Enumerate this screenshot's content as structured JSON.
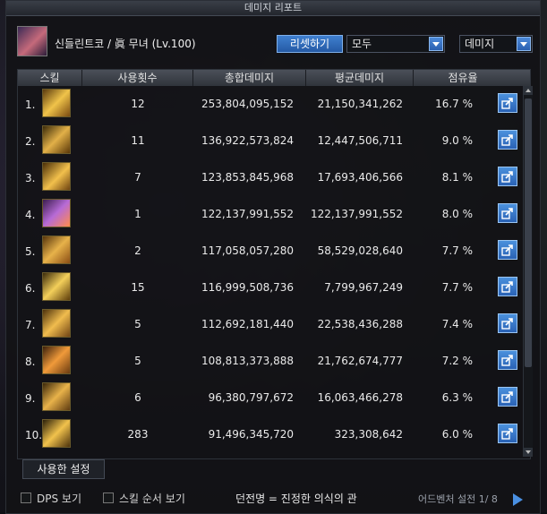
{
  "window": {
    "title": "데미지 리포트"
  },
  "header": {
    "character_name": "신들린트코 / 眞 무녀 (Lv.100)",
    "reset_label": "리셋하기",
    "scope_select": {
      "value": "모두"
    },
    "metric_select": {
      "value": "데미지"
    }
  },
  "table": {
    "columns": [
      "스킬",
      "사용횟수",
      "총합데미지",
      "평균데미지",
      "점유율"
    ],
    "rows": [
      {
        "rank": "1.",
        "count": "12",
        "total": "253,804,095,152",
        "avg": "21,150,341,262",
        "share": "16.7 %",
        "icon": "skill-icon-gold-burst"
      },
      {
        "rank": "2.",
        "count": "11",
        "total": "136,922,573,824",
        "avg": "12,447,506,711",
        "share": "9.0 %",
        "icon": "skill-icon-dragon"
      },
      {
        "rank": "3.",
        "count": "7",
        "total": "123,853,845,968",
        "avg": "17,693,406,566",
        "share": "8.1 %",
        "icon": "skill-icon-orb"
      },
      {
        "rank": "4.",
        "count": "1",
        "total": "122,137,991,552",
        "avg": "122,137,991,552",
        "share": "8.0 %",
        "icon": "skill-icon-purple-fox"
      },
      {
        "rank": "5.",
        "count": "2",
        "total": "117,058,057,280",
        "avg": "58,529,028,640",
        "share": "7.7 %",
        "icon": "skill-icon-fist"
      },
      {
        "rank": "6.",
        "count": "15",
        "total": "116,999,508,736",
        "avg": "7,799,967,249",
        "share": "7.7 %",
        "icon": "skill-icon-swirl"
      },
      {
        "rank": "7.",
        "count": "5",
        "total": "112,692,181,440",
        "avg": "22,538,436,288",
        "share": "7.4 %",
        "icon": "skill-icon-flurry"
      },
      {
        "rank": "8.",
        "count": "5",
        "total": "108,813,373,888",
        "avg": "21,762,674,777",
        "share": "7.2 %",
        "icon": "skill-icon-flame-dash"
      },
      {
        "rank": "9.",
        "count": "6",
        "total": "96,380,797,672",
        "avg": "16,063,466,278",
        "share": "6.3 %",
        "icon": "skill-icon-claw"
      },
      {
        "rank": "10.",
        "count": "283",
        "total": "91,496,345,720",
        "avg": "323,308,642",
        "share": "6.0 %",
        "icon": "skill-icon-comet"
      }
    ]
  },
  "tabs": {
    "used_settings": "사용한 설정"
  },
  "footer": {
    "dps_label": "DPS 보기",
    "skill_order_label": "스킬 순서 보기",
    "dungeon_label": "던전명 = 진정한 의식의 관",
    "right_text": "어드벤처 설전 1/ 8"
  },
  "colors": {
    "accent": "#2f6fc4",
    "button_border": "#9cc6f2"
  }
}
